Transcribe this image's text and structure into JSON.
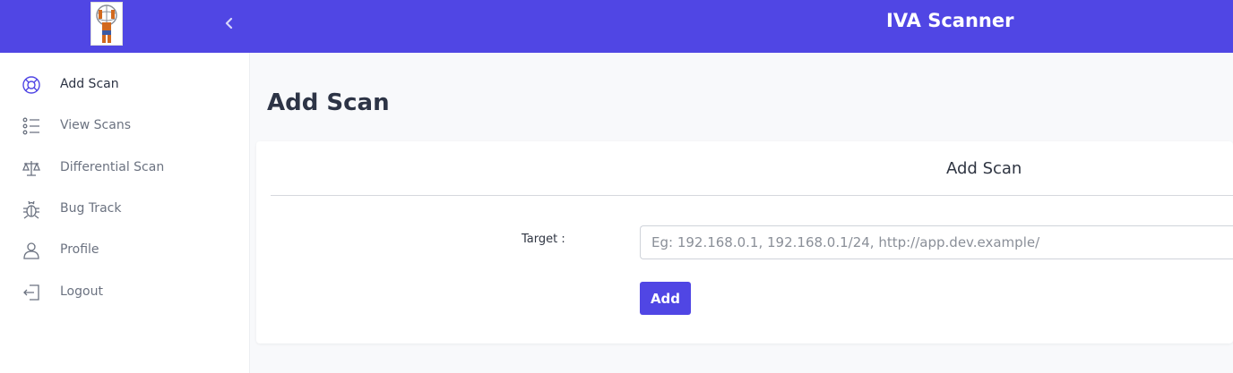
{
  "header": {
    "title": "IVA Scanner",
    "logo_icon": "atlas-logo-icon",
    "collapse_icon": "chevron-left-icon",
    "brand_color": "#5046e4"
  },
  "sidebar": {
    "items": [
      {
        "label": "Add Scan",
        "icon": "lifebuoy-icon",
        "active": true
      },
      {
        "label": "View Scans",
        "icon": "list-icon",
        "active": false
      },
      {
        "label": "Differential Scan",
        "icon": "scale-icon",
        "active": false
      },
      {
        "label": "Bug Track",
        "icon": "bug-icon",
        "active": false
      },
      {
        "label": "Profile",
        "icon": "user-icon",
        "active": false
      },
      {
        "label": "Logout",
        "icon": "logout-icon",
        "active": false
      }
    ]
  },
  "main": {
    "page_title": "Add Scan",
    "card": {
      "title": "Add Scan",
      "target_label": "Target :",
      "target_placeholder": "Eg: 192.168.0.1, 192.168.0.1/24, http://app.dev.example/",
      "target_value": "",
      "add_label": "Add"
    }
  }
}
